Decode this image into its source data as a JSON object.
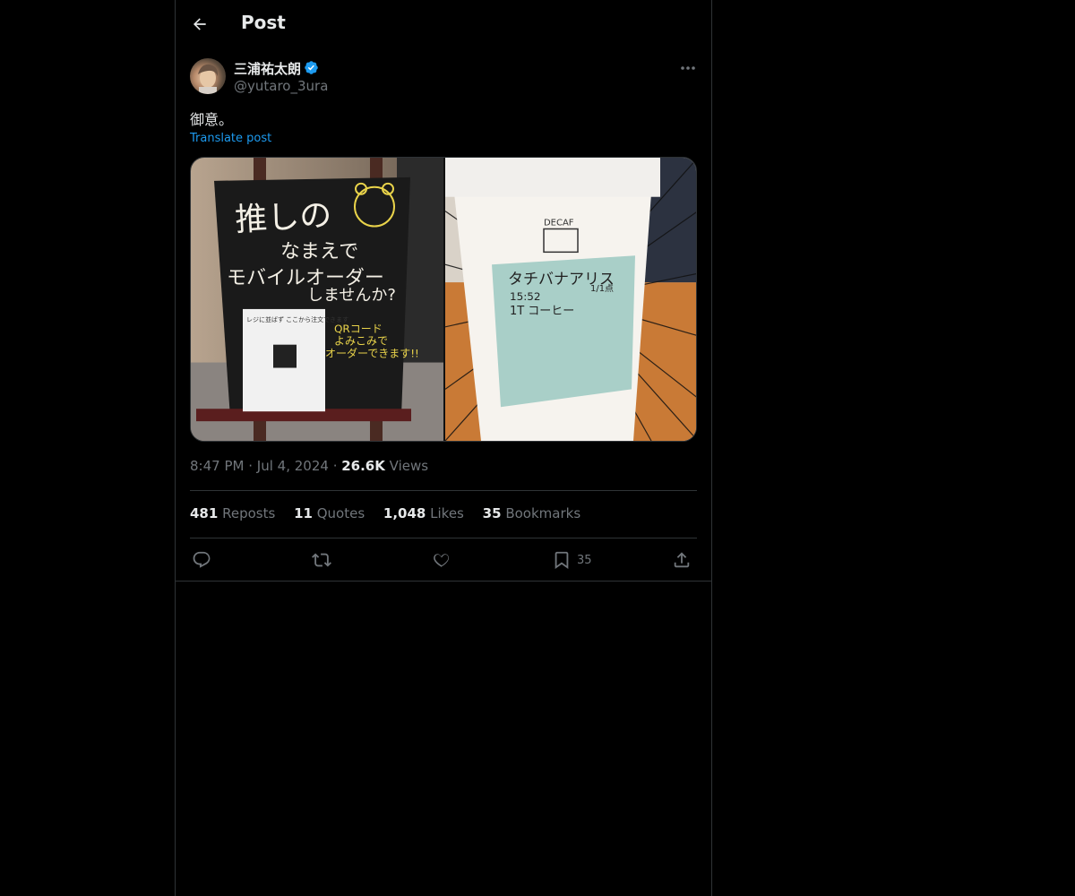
{
  "header": {
    "title": "Post"
  },
  "author": {
    "display_name": "三浦祐太朗",
    "handle": "@yutaro_3ura",
    "verified_color": "#1d9bf0"
  },
  "post": {
    "text": "御意。",
    "translate_label": "Translate post",
    "time": "8:47 PM",
    "date": "Jul 4, 2024",
    "views_count": "26.6K",
    "views_label": "Views",
    "images": [
      {
        "name": "left-image",
        "sign_lines": [
          "推しの",
          "なまえで",
          "モバイルオーダー",
          "しませんか?"
        ],
        "card_text": "レジに並ばず ここから注文できます",
        "qr_text": [
          "QRコード",
          "よみこみで",
          "オーダーできます!!"
        ]
      },
      {
        "name": "right-image",
        "cup_label_line1": "タチバナアリス",
        "cup_label_line2": "15:52",
        "cup_label_line3": "1T コーヒー",
        "cup_corner": "1/1点",
        "cup_top": "DECAF"
      }
    ]
  },
  "stats": {
    "reposts_count": "481",
    "reposts_label": "Reposts",
    "quotes_count": "11",
    "quotes_label": "Quotes",
    "likes_count": "1,048",
    "likes_label": "Likes",
    "bookmarks_count": "35",
    "bookmarks_label": "Bookmarks"
  },
  "actions": {
    "bookmark_count": "35"
  },
  "colors": {
    "background": "#000000",
    "text": "#e7e9ea",
    "muted": "#71767b",
    "accent": "#1d9bf0",
    "border": "#2f3336"
  }
}
